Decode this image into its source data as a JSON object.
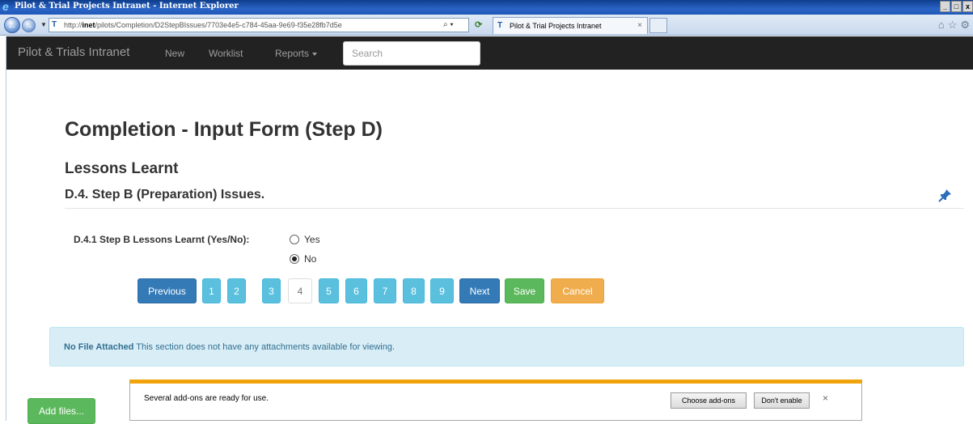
{
  "browser": {
    "window_title": "Pilot & Trial Projects Intranet - Internet Explorer",
    "window_controls": [
      "_",
      "□",
      "x"
    ],
    "address_prefix": "http://",
    "address_host": "inet",
    "address_path": "/pilots/Completion/D2StepBIssues/7703e4e5-c784-45aa-9e69-f35e28fb7d5e",
    "tab_label": "Pilot & Trial Projects Intranet",
    "tab_close": "×",
    "icons": [
      "back-icon",
      "forward-icon",
      "search-icon",
      "refresh-icon",
      "home-icon",
      "favorites-star-icon",
      "tools-gear-icon"
    ]
  },
  "navbar": {
    "brand": "Pilot & Trials Intranet",
    "links": {
      "new": "New",
      "worklist": "Worklist",
      "reports": "Reports"
    },
    "search_placeholder": "Search",
    "background": "#222222"
  },
  "main": {
    "title": "Completion - Input Form (Step D)",
    "section": "Lessons Learnt",
    "subsection": "D.4. Step B (Preparation) Issues.",
    "question": {
      "label": "D.4.1 Step B Lessons Learnt (Yes/No):",
      "options": [
        "Yes",
        "No"
      ],
      "selected": "No"
    }
  },
  "pager": {
    "previous": "Previous",
    "pages": [
      "1",
      "2",
      "3",
      "4",
      "5",
      "6",
      "7",
      "8",
      "9"
    ],
    "current_page": "4",
    "next": "Next",
    "save": "Save",
    "cancel": "Cancel",
    "colors": {
      "primary": "#337ab7",
      "info": "#5bc0de",
      "success": "#5cb85c",
      "warning": "#f0ad4e"
    }
  },
  "attachments": {
    "strong": "No File Attached",
    "text": " This section does not have any attachments available for viewing.",
    "add_files": "Add files..."
  },
  "notification": {
    "text": "Several add-ons are ready for use.",
    "choose": "Choose add-ons",
    "dont_enable": "Don't enable",
    "close": "×"
  }
}
